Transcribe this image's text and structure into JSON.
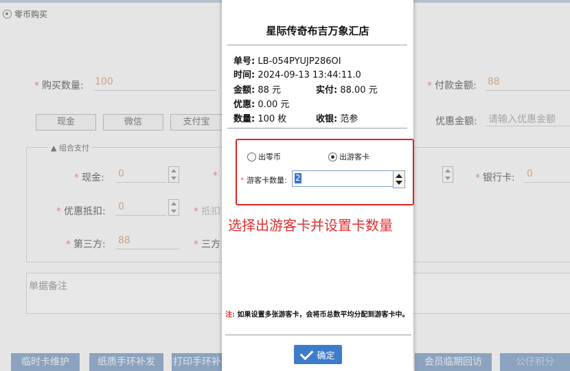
{
  "background": {
    "tab_title": "零币购买",
    "purchase_qty_label": "购买数量:",
    "purchase_qty_value": "100",
    "pay_amount_label": "付款金额:",
    "pay_amount_value": "88",
    "discount_amount_label": "优惠金额:",
    "discount_amount_placeholder": "请输入优惠金额",
    "pay_methods": [
      "现金",
      "微信",
      "支付宝"
    ],
    "group_legend": "组合支付",
    "cash_label": "现金:",
    "cash_value": "0",
    "bank_label": "银行卡:",
    "bank_value": "0",
    "discount_offset_label": "优惠抵扣:",
    "discount_offset_value": "0",
    "offset_partial": "抵扣",
    "third_party_label": "第三方:",
    "third_party_value": "88",
    "third_party2_partial": "三方",
    "remark_label": "单据备注",
    "bottom_buttons": [
      "临时卡维护",
      "纸质手环补发",
      "打印手环补",
      "会员临期回访",
      "公仔积分"
    ]
  },
  "receipt": {
    "store_name": "星际传奇布吉万象汇店",
    "order_label": "单号:",
    "order_value": "LB-054PYUJP286OI",
    "time_label": "时间:",
    "time_value": "2024-09-13 13:44:11.0",
    "amount_label": "金额:",
    "amount_value": "88 元",
    "paid_label": "实付:",
    "paid_value": "88.00 元",
    "discount_label": "优惠:",
    "discount_value": "0.00 元",
    "qty_label": "数量:",
    "qty_value": "100 枚",
    "cashier_label": "收银:",
    "cashier_value": "范参"
  },
  "options": {
    "radio_coin": "出零币",
    "radio_card": "出游客卡",
    "selected": "出游客卡",
    "card_qty_label": "游客卡数量:",
    "card_qty_value": "2"
  },
  "annotation": "选择出游客卡并设置卡数量",
  "note": {
    "prefix": "注:",
    "text": "如果设置多张游客卡，会将币总数平均分配到游客卡中。"
  },
  "confirm_label": "确定"
}
